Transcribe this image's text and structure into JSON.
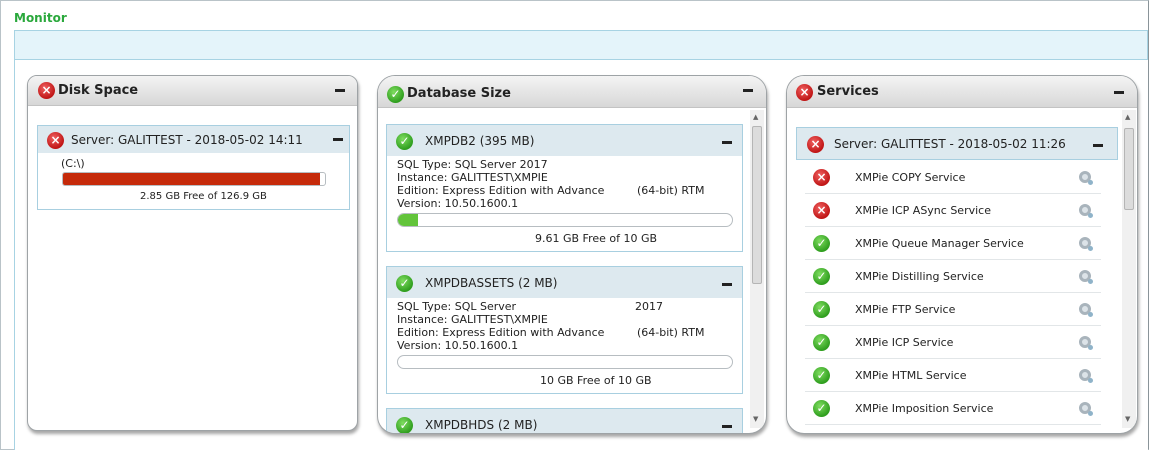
{
  "page": {
    "title": "Monitor"
  },
  "disk_panel": {
    "title": "Disk Space",
    "status": "error",
    "server": {
      "label": "Server: GALITTEST -  2018-05-02 14:11",
      "status": "error",
      "drive": "(C:\\)",
      "used_fraction": 0.98,
      "free_text": "2.85 GB Free of 126.9 GB",
      "bar_color": "#c52a0a"
    }
  },
  "db_panel": {
    "title": "Database Size",
    "status": "ok",
    "databases": [
      {
        "name": "XMPDB2 (395 MB)",
        "status": "ok",
        "sql_type": "SQL Type: SQL Server 2017",
        "instance": "Instance: GALITTEST\\XMPIE",
        "edition": "Edition: Express Edition with Advance",
        "edition_suffix": "(64-bit) RTM",
        "version": "Version: 10.50.1600.1",
        "used_fraction": 0.06,
        "free_text": "9.61 GB Free of 10 GB",
        "bar_color": "#62c43a"
      },
      {
        "name": "XMPDBASSETS (2 MB)",
        "status": "ok",
        "sql_type": "SQL Type: SQL Server",
        "sql_year": "2017",
        "instance": "Instance: GALITTEST\\XMPIE",
        "edition": "Edition: Express Edition with Advance",
        "edition_suffix": "(64-bit) RTM",
        "version": "Version: 10.50.1600.1",
        "used_fraction": 0.0,
        "free_text": "10 GB Free of 10 GB",
        "bar_color": "#62c43a"
      },
      {
        "name": "XMPDBHDS (2 MB)",
        "status": "ok"
      }
    ]
  },
  "services_panel": {
    "title": "Services",
    "status": "error",
    "server": {
      "label": "Server: GALITTEST - 2018-05-02  11:26",
      "status": "error"
    },
    "services": [
      {
        "name": "XMPie COPY Service",
        "status": "error"
      },
      {
        "name": "XMPie ICP ASync Service",
        "status": "error"
      },
      {
        "name": "XMPie Queue Manager Service",
        "status": "ok"
      },
      {
        "name": "XMPie Distilling Service",
        "status": "ok"
      },
      {
        "name": "XMPie FTP Service",
        "status": "ok"
      },
      {
        "name": "XMPie ICP Service",
        "status": "ok"
      },
      {
        "name": "XMPie HTML Service",
        "status": "ok"
      },
      {
        "name": "XMPie Imposition Service",
        "status": "ok"
      }
    ]
  },
  "icons": {
    "error": "x-circle-icon",
    "ok": "check-circle-icon",
    "collapse": "minus-icon",
    "settings": "gear-icon"
  },
  "colors": {
    "title_green": "#2aa83c",
    "error_red": "#c01616",
    "ok_green": "#2f9e1e"
  }
}
